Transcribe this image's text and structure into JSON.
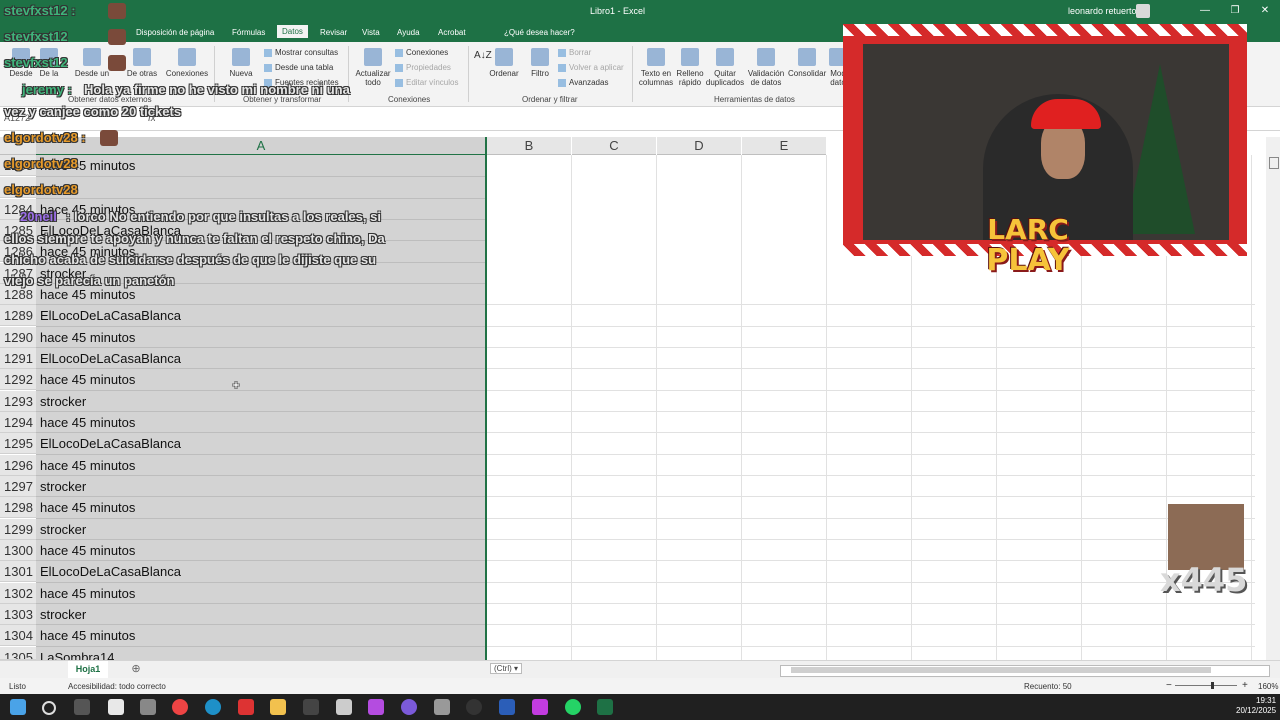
{
  "titlebar": {
    "title": "Libro1  -  Excel",
    "user": "leonardo retuerto",
    "minimize_icon": "—",
    "restore_icon": "❐",
    "close_icon": "✕"
  },
  "tabs": [
    {
      "label": "Disposición de página"
    },
    {
      "label": "Fórmulas"
    },
    {
      "label": "Datos",
      "active": true
    },
    {
      "label": "Revisar"
    },
    {
      "label": "Vista"
    },
    {
      "label": "Ayuda"
    },
    {
      "label": "Acrobat"
    },
    {
      "label": "¿Qué desea hacer?"
    }
  ],
  "ribbon": {
    "btn_desde": "Desde",
    "btn_de_la": "De la",
    "btn_desde_un": "Desde un",
    "btn_otras": "De otras",
    "btn_conexiones_exist": "Conexiones",
    "btn_nueva": "Nueva",
    "mostrar_consultas": "Mostrar consultas",
    "desde_tabla": "Desde una tabla",
    "fuentes_recientes": "Fuentes recientes",
    "btn_actualizar": "Actualizar",
    "btn_actualizar_2": "todo",
    "conexiones": "Conexiones",
    "propiedades": "Propiedades",
    "editar_vinculos": "Editar vínculos",
    "btn_ordenar": "Ordenar",
    "btn_filtro": "Filtro",
    "borrar": "Borrar",
    "volver_aplicar": "Volver a aplicar",
    "avanzadas": "Avanzadas",
    "btn_texto_columnas": "Texto en",
    "btn_texto_columnas_2": "columnas",
    "btn_relleno": "Relleno",
    "btn_relleno_2": "rápido",
    "btn_quitar": "Quitar",
    "btn_quitar_2": "duplicados",
    "btn_validacion": "Validación",
    "btn_validacion_2": "de datos",
    "btn_consolidar": "Consolidar",
    "btn_mod": "Mod",
    "btn_mod_2": "dato",
    "group_obtener_externos": "Obtener datos externos",
    "group_obtener_transformar": "Obtener y transformar",
    "group_conexiones": "Conexiones",
    "group_ordenar": "Ordenar y filtrar",
    "group_herramientas": "Herramientas de datos"
  },
  "formula_bar": {
    "name_box": "A1272",
    "fx": "fx"
  },
  "columns": [
    "A",
    "B",
    "C",
    "D",
    "E"
  ],
  "rows": [
    {
      "num": "1283",
      "value": "hace 45 minutos"
    },
    {
      "num": "",
      "value": ""
    },
    {
      "num": "1284",
      "value": "hace 45 minutos"
    },
    {
      "num": "1285",
      "value": "ElLocoDeLaCasaBlanca"
    },
    {
      "num": "1286",
      "value": "hace 45 minutos"
    },
    {
      "num": "1287",
      "value": "strocker"
    },
    {
      "num": "1288",
      "value": "hace 45 minutos"
    },
    {
      "num": "1289",
      "value": "ElLocoDeLaCasaBlanca"
    },
    {
      "num": "1290",
      "value": "hace 45 minutos"
    },
    {
      "num": "1291",
      "value": "ElLocoDeLaCasaBlanca"
    },
    {
      "num": "1292",
      "value": "hace 45 minutos"
    },
    {
      "num": "1293",
      "value": "strocker"
    },
    {
      "num": "1294",
      "value": "hace 45 minutos"
    },
    {
      "num": "1295",
      "value": "ElLocoDeLaCasaBlanca"
    },
    {
      "num": "1296",
      "value": "hace 45 minutos"
    },
    {
      "num": "1297",
      "value": "strocker"
    },
    {
      "num": "1298",
      "value": "hace 45 minutos"
    },
    {
      "num": "1299",
      "value": "strocker"
    },
    {
      "num": "1300",
      "value": "hace 45 minutos"
    },
    {
      "num": "1301",
      "value": "ElLocoDeLaCasaBlanca"
    },
    {
      "num": "1302",
      "value": "hace 45 minutos"
    },
    {
      "num": "1303",
      "value": "strocker"
    },
    {
      "num": "1304",
      "value": "hace 45 minutos"
    },
    {
      "num": "1305",
      "value": "LaSombra14"
    }
  ],
  "sheet": {
    "tab": "Hoja1",
    "add": "⊕",
    "paste_ctrl": "(Ctrl) ▾"
  },
  "status": {
    "ready": "Listo",
    "accessibility": "Accesibilidad: todo correcto",
    "count": "Recuento: 50",
    "zoom": "160%",
    "zoom_minus": "−",
    "zoom_plus": "+"
  },
  "clock": {
    "time": "19:31",
    "date": "20/12/2025"
  },
  "chat": {
    "user1": "stevfxst12 :",
    "user1b": "stevfxst12",
    "user2": "jeremy :",
    "msg2a": "Hola ya firme no he visto mi nombre ni una",
    "msg2b": "vez y canjee como 20 tickets",
    "user3": "elgordotv28 :",
    "user3b": "elgordotv28",
    "user3c": "elgordotv28",
    "user4": "20neil",
    "msg4a": ": lorco No entiendo por que insultas a los reales, si",
    "msg4b": "ellos siempre te apoyan y nunca te faltan el respeto chino, Da",
    "msg4c": "chicho acaba de suicidarse después de que le dijiste que su",
    "msg4d": "viejo se parecía un panetón"
  },
  "overlay": {
    "logo_line1": "LARC",
    "logo_line2": "PLAY",
    "meme_count": "x445"
  },
  "colors": {
    "excel_green": "#1e7145",
    "selection_gray": "#d3d3d3",
    "webcam_frame": "#d52a2a"
  }
}
